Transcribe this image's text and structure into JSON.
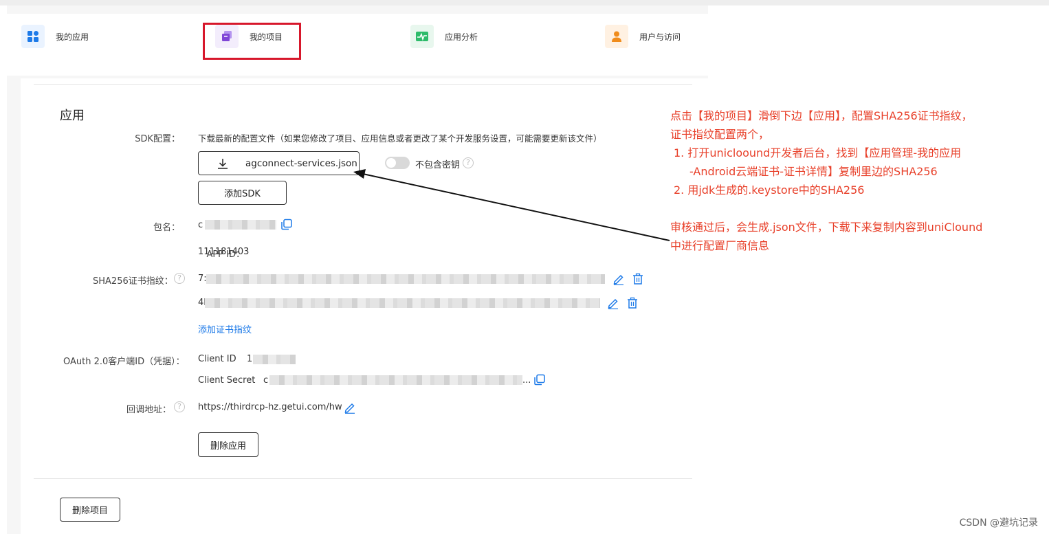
{
  "nav": {
    "items": [
      {
        "label": "我的应用",
        "icon": "grid-apps-icon",
        "color": "#1d7ae8"
      },
      {
        "label": "我的项目",
        "icon": "project-stack-icon",
        "color": "#8a4fdc"
      },
      {
        "label": "应用分析",
        "icon": "analytics-chart-icon",
        "color": "#2dbb6a"
      },
      {
        "label": "用户与访问",
        "icon": "user-icon",
        "color": "#f08c1c"
      }
    ]
  },
  "app_section": {
    "title": "应用",
    "sdk_label": "SDK配置：",
    "sdk_description": "下载最新的配置文件（如果您修改了项目、应用信息或者更改了某个开发服务设置，可能需要更新该文件）",
    "download_file": "agconnect-services.json",
    "toggle_label": "不包含密钥",
    "add_sdk": "添加SDK",
    "package_label": "包名：",
    "package_prefix": "c",
    "app_id_label": "APP ID：",
    "app_id": "111181403",
    "sha_label": "SHA256证书指纹：",
    "sha1_prefix": "7:",
    "sha2_prefix": "4I",
    "add_cert": "添加证书指纹",
    "oauth_label": "OAuth 2.0客户端ID（凭据）：",
    "client_id_label": "Client ID",
    "client_id_prefix": "1",
    "client_secret_label": "Client Secret",
    "client_secret_prefix": "c",
    "client_secret_suffix": "...",
    "callback_label": "回调地址：",
    "callback_url": "https://thirdrcp-hz.getui.com/hw",
    "delete_app": "删除应用",
    "delete_project": "删除项目"
  },
  "annotation": {
    "line1": "点击【我的项目】滑倒下边【应用】，配置SHA256证书指纹，",
    "line2": "证书指纹配置两个，",
    "line3": "1.  打开unicloound开发者后台，找到【应用管理-我的应用",
    "line4": "-Android云端证书-证书详情】复制里边的SHA256",
    "line5": "2.  用jdk生成的.keystore中的SHA256",
    "line6": "审核通过后，会生成.json文件，下载下来复制内容到uniClound",
    "line7": "中进行配置厂商信息",
    "color": "#e8402a"
  },
  "watermark": "CSDN @避坑记录"
}
